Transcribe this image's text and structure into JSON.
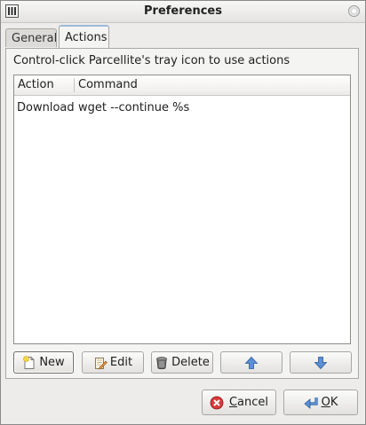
{
  "window": {
    "title": "Preferences"
  },
  "tabs": [
    {
      "label": "General"
    },
    {
      "label": "Actions"
    }
  ],
  "actions_panel": {
    "hint": "Control-click Parcellite's tray icon to use actions",
    "columns": {
      "action": "Action",
      "command": "Command"
    },
    "rows": [
      {
        "action": "Download",
        "command": "wget --continue %s"
      }
    ]
  },
  "buttons": {
    "new": "New",
    "edit": "Edit",
    "delete": "Delete",
    "move_up_icon": "up-arrow-icon",
    "move_down_icon": "down-arrow-icon",
    "cancel_mnemonic": "C",
    "cancel_rest": "ancel",
    "ok_mnemonic": "O",
    "ok_rest": "K"
  }
}
